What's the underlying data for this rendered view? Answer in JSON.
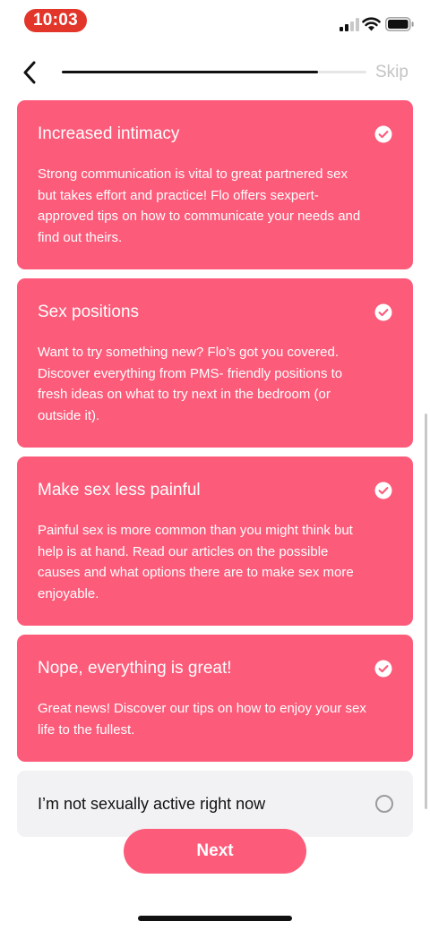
{
  "status_bar": {
    "time": "10:03",
    "time_pill_color": "#e2362b"
  },
  "nav": {
    "back_icon": "chevron-left-icon",
    "progress": 0.84,
    "skip_label": "Skip"
  },
  "options": [
    {
      "title": "Increased intimacy",
      "description": "Strong communication is vital to great partnered sex but takes effort and practice! Flo offers sexpert-approved tips on how to communicate your needs and find out theirs.",
      "selected": true
    },
    {
      "title": "Sex positions",
      "description": "Want to try something new? Flo’s got you covered. Discover everything from PMS- friendly positions to fresh ideas on what to try next in the bedroom (or outside it).",
      "selected": true
    },
    {
      "title": "Make sex less painful",
      "description": "Painful sex is more common than you might think but help is at hand. Read our articles on the possible causes and what options there are to make sex more enjoyable.",
      "selected": true
    },
    {
      "title": "Nope, everything is great!",
      "description": "Great news! Discover our tips on how to enjoy your sex life to the fullest.",
      "selected": true
    },
    {
      "title": "I’m not sexually active right now",
      "selected": false
    }
  ],
  "colors": {
    "accent": "#fc5b7a",
    "unselected_bg": "#f2f2f4"
  },
  "next_label": "Next"
}
